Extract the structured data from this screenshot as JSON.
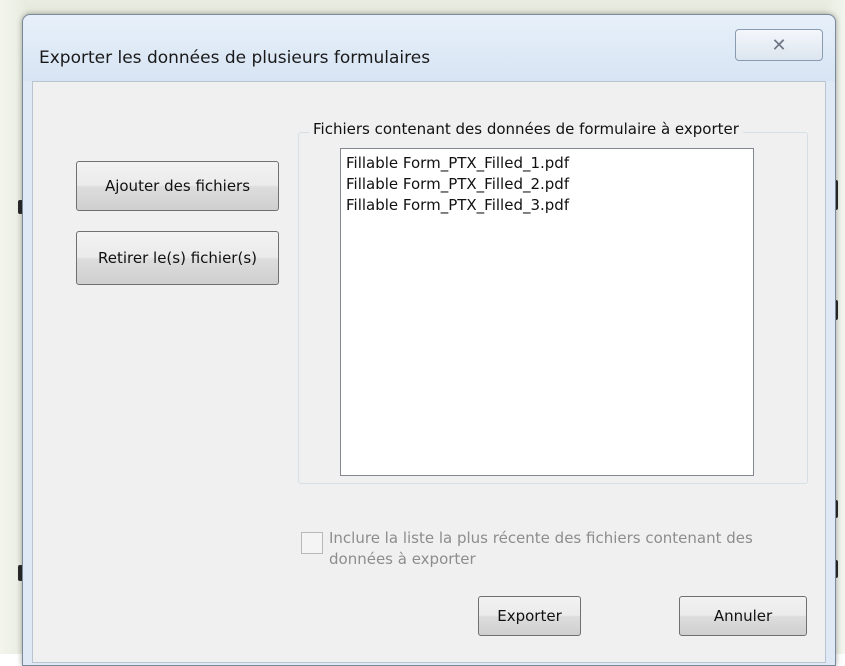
{
  "dialog": {
    "title": "Exporter les données de plusieurs formulaires",
    "close_glyph": "✕"
  },
  "buttons": {
    "add_files": "Ajouter des fichiers",
    "remove_files": "Retirer le(s) fichier(s)",
    "export": "Exporter",
    "cancel": "Annuler"
  },
  "file_group": {
    "label": "Fichiers contenant des données de formulaire à exporter",
    "files": [
      "Fillable Form_PTX_Filled_1.pdf",
      "Fillable Form_PTX_Filled_2.pdf",
      "Fillable Form_PTX_Filled_3.pdf"
    ]
  },
  "option": {
    "label": "Inclure la liste la plus récente des fichiers contenant des données à exporter",
    "checked": false,
    "enabled": false
  },
  "colors": {
    "title_bar": "#dfe9f5",
    "client_bg": "#f0f0f0",
    "disabled_text": "#8d8d8d"
  }
}
